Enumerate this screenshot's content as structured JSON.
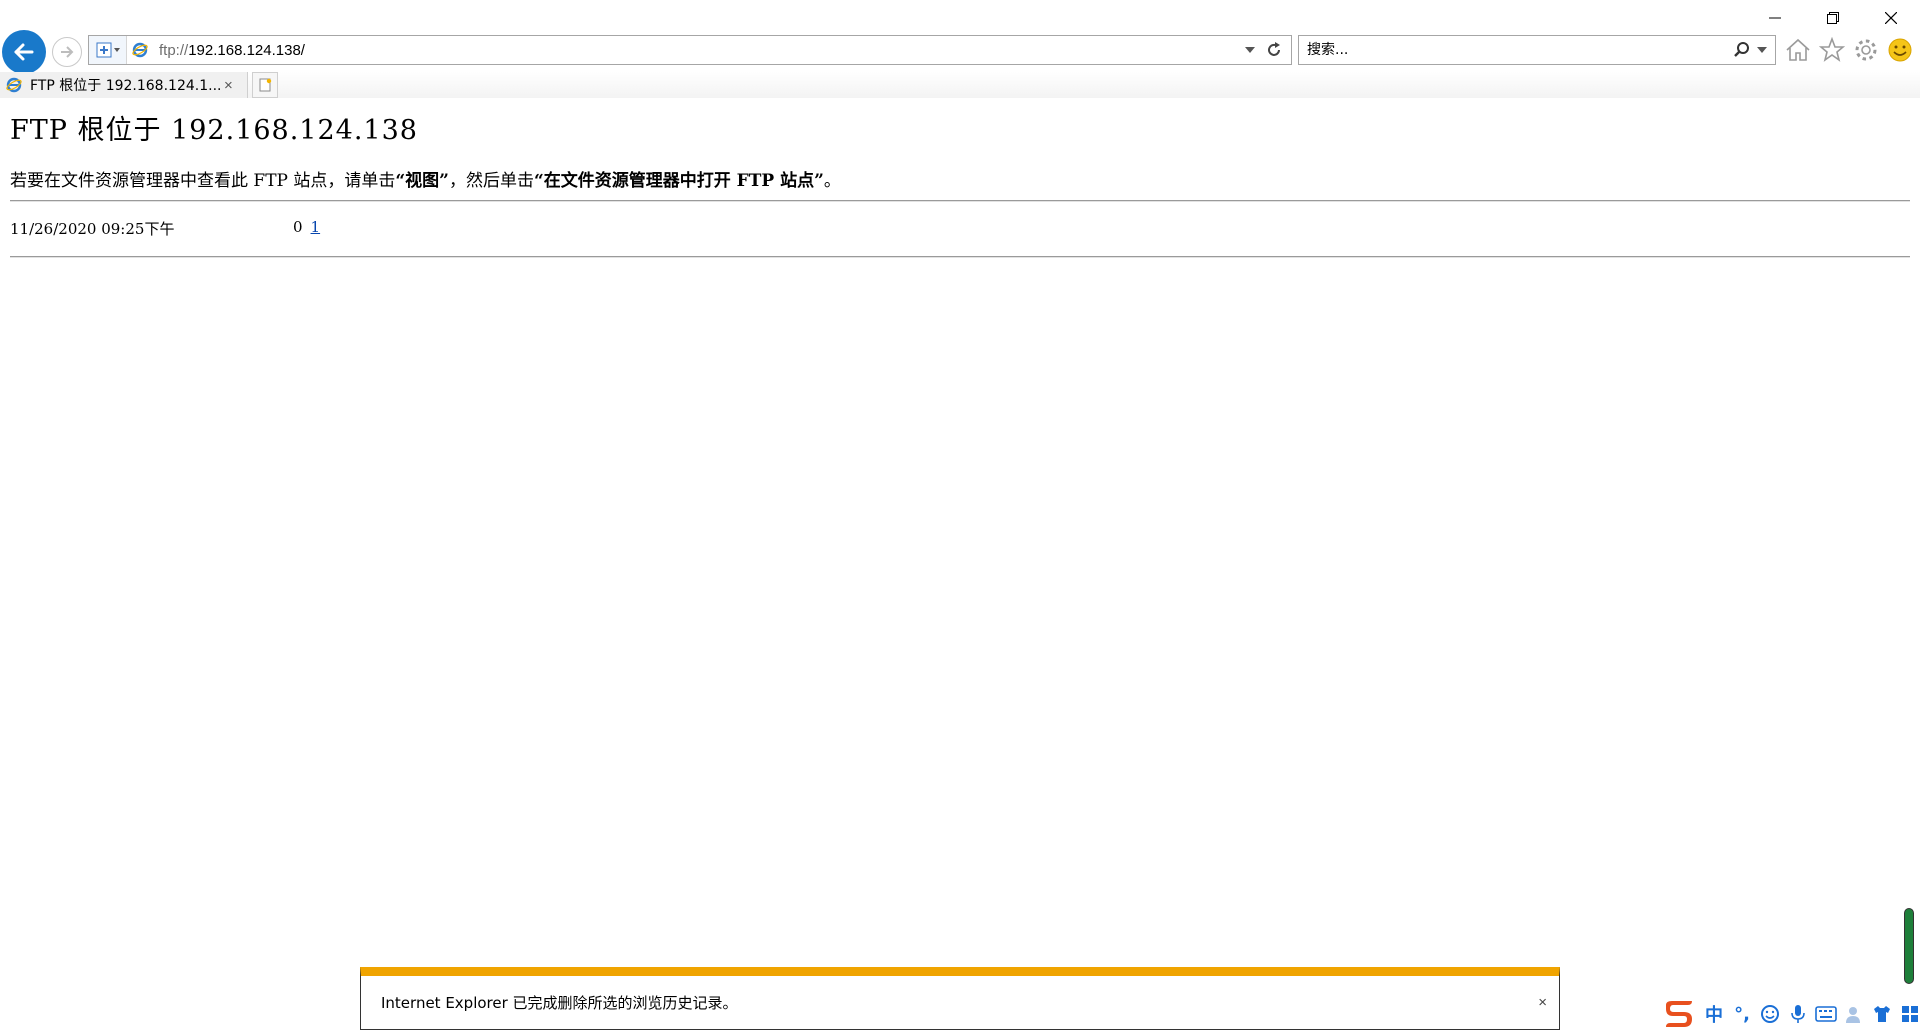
{
  "window": {
    "minimize_label": "",
    "restore_label": "",
    "close_label": ""
  },
  "address_bar": {
    "url_scheme": "ftp://",
    "url_host": "192.168.124.138/"
  },
  "search": {
    "placeholder": "搜索..."
  },
  "tab": {
    "title": "FTP 根位于 192.168.124.1...",
    "close_glyph": "×"
  },
  "page": {
    "title": "FTP 根位于 192.168.124.138",
    "instruction_prefix": "若要在文件资源管理器中查看此 FTP 站点，请单击",
    "instruction_view": "“视图”",
    "instruction_middle": "，然后单击",
    "instruction_open": "“在文件资源管理器中打开 FTP 站点”",
    "instruction_suffix": "。",
    "listing": [
      {
        "date": "11/26/2020 09:25下午",
        "size": "0",
        "name": "1"
      }
    ]
  },
  "notification": {
    "message": "Internet Explorer 已完成删除所选的浏览历史记录。",
    "close_glyph": "×"
  },
  "ime": {
    "mode_label": "中",
    "punct_label": "°,"
  },
  "colors": {
    "back_button": "#1979ca",
    "notification_accent": "#f0a400",
    "link": "#0645ad",
    "ime_logo": "#e8501e",
    "ime_icons": "#1a6fd6",
    "gauge": "#1e7f3a"
  }
}
